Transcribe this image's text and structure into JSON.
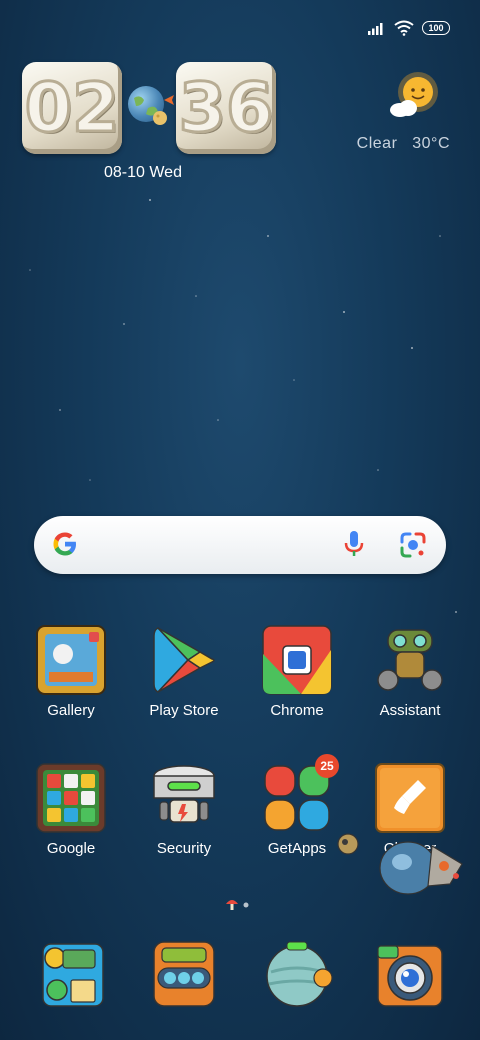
{
  "status_bar": {
    "battery": "100",
    "icons": [
      "signal-icon",
      "wifi-icon",
      "battery-icon"
    ]
  },
  "clock": {
    "time_hours": "02",
    "time_minutes": "36",
    "date": "08-10 Wed"
  },
  "weather": {
    "condition": "Clear",
    "temperature": "30°C",
    "icon": "sun-cloud-icon"
  },
  "search": {
    "icons": [
      "google-g-icon",
      "microphone-icon",
      "lens-camera-icon"
    ]
  },
  "apps_row1": [
    {
      "label": "Gallery",
      "icon": "gallery-icon"
    },
    {
      "label": "Play Store",
      "icon": "play-store-icon"
    },
    {
      "label": "Chrome",
      "icon": "chrome-icon"
    },
    {
      "label": "Assistant",
      "icon": "assistant-icon"
    }
  ],
  "apps_row2": [
    {
      "label": "Google",
      "icon": "google-folder-icon"
    },
    {
      "label": "Security",
      "icon": "security-icon"
    },
    {
      "label": "GetApps",
      "icon": "getapps-icon",
      "badge": "25"
    },
    {
      "label": "Cleaner",
      "icon": "cleaner-icon"
    }
  ],
  "dock": [
    {
      "icon": "phone-icon"
    },
    {
      "icon": "messages-icon"
    },
    {
      "icon": "browser-icon"
    },
    {
      "icon": "camera-icon"
    }
  ],
  "colors": {
    "background": "#143a5a",
    "badge": "#e8482c"
  }
}
